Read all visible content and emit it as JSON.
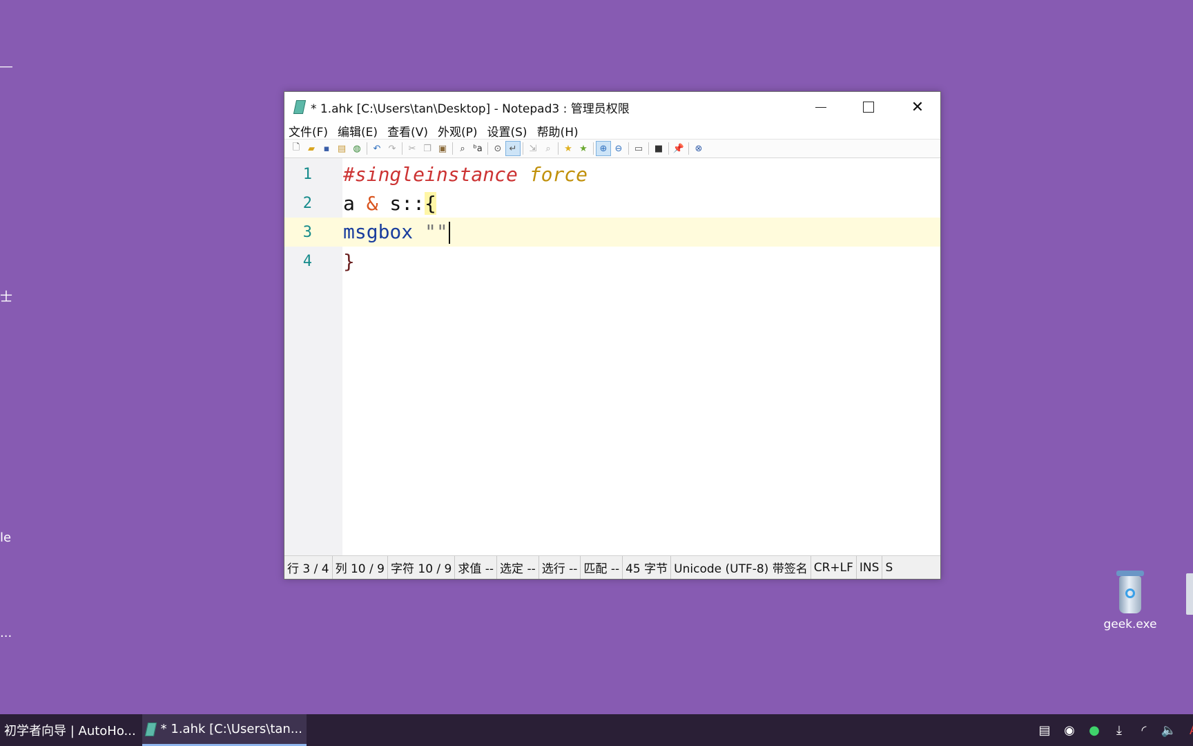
{
  "desktop": {
    "left_fragments": [
      "―",
      "士",
      "le",
      "..."
    ],
    "icons": [
      {
        "label": "geek.exe"
      }
    ]
  },
  "window": {
    "title": "* 1.ahk [C:\\Users\\tan\\Desktop] - Notepad3 : 管理员权限",
    "controls": {
      "minimize": "minimize",
      "maximize": "maximize",
      "close": "close"
    },
    "menu": [
      "文件(F)",
      "编辑(E)",
      "查看(V)",
      "外观(P)",
      "设置(S)",
      "帮助(H)"
    ],
    "toolbar_icons": [
      "new-file-icon",
      "open-file-icon",
      "save-icon",
      "save-as-icon",
      "browse-icon",
      "undo-icon",
      "redo-icon",
      "cut-icon",
      "copy-icon",
      "paste-icon",
      "find-icon",
      "replace-icon",
      "find-in-files-icon",
      "word-wrap-icon",
      "goto-icon",
      "zoom-icon",
      "bookmark-icon",
      "favorites-icon",
      "zoom-in-icon",
      "zoom-out-icon",
      "view-icon",
      "screen-icon",
      "pin-icon",
      "exit-icon"
    ],
    "editor": {
      "lines": [
        {
          "num": "1",
          "tokens": [
            {
              "t": "#singleinstance",
              "c": "dir"
            },
            {
              "t": " ",
              "c": "plain"
            },
            {
              "t": "force",
              "c": "force"
            }
          ]
        },
        {
          "num": "2",
          "tokens": [
            {
              "t": "a",
              "c": "plain"
            },
            {
              "t": " ",
              "c": "plain"
            },
            {
              "t": "&",
              "c": "op"
            },
            {
              "t": " s::",
              "c": "plain"
            },
            {
              "t": "{",
              "c": "brace"
            }
          ]
        },
        {
          "num": "3",
          "tokens": [
            {
              "t": "msgbox",
              "c": "kw"
            },
            {
              "t": " ",
              "c": "plain"
            },
            {
              "t": "\"\"",
              "c": "str"
            }
          ]
        },
        {
          "num": "4",
          "tokens": [
            {
              "t": "}",
              "c": "brace"
            }
          ]
        }
      ]
    },
    "status": [
      "行  3 / 4",
      "列  10 / 9",
      "字符  10 / 9",
      "求值  --",
      "选定  --",
      "选行  --",
      "匹配  --",
      "45 字节",
      "Unicode (UTF-8) 带签名",
      "CR+LF",
      "INS",
      "S"
    ]
  },
  "taskbar": {
    "tasks": [
      "初学者向导 | AutoHo...",
      "* 1.ahk [C:\\Users\\tan..."
    ],
    "tray_icons": [
      "message-icon",
      "obs-icon",
      "wechat-icon",
      "download-icon",
      "wifi-icon",
      "volume-icon",
      "input-method-icon"
    ]
  }
}
